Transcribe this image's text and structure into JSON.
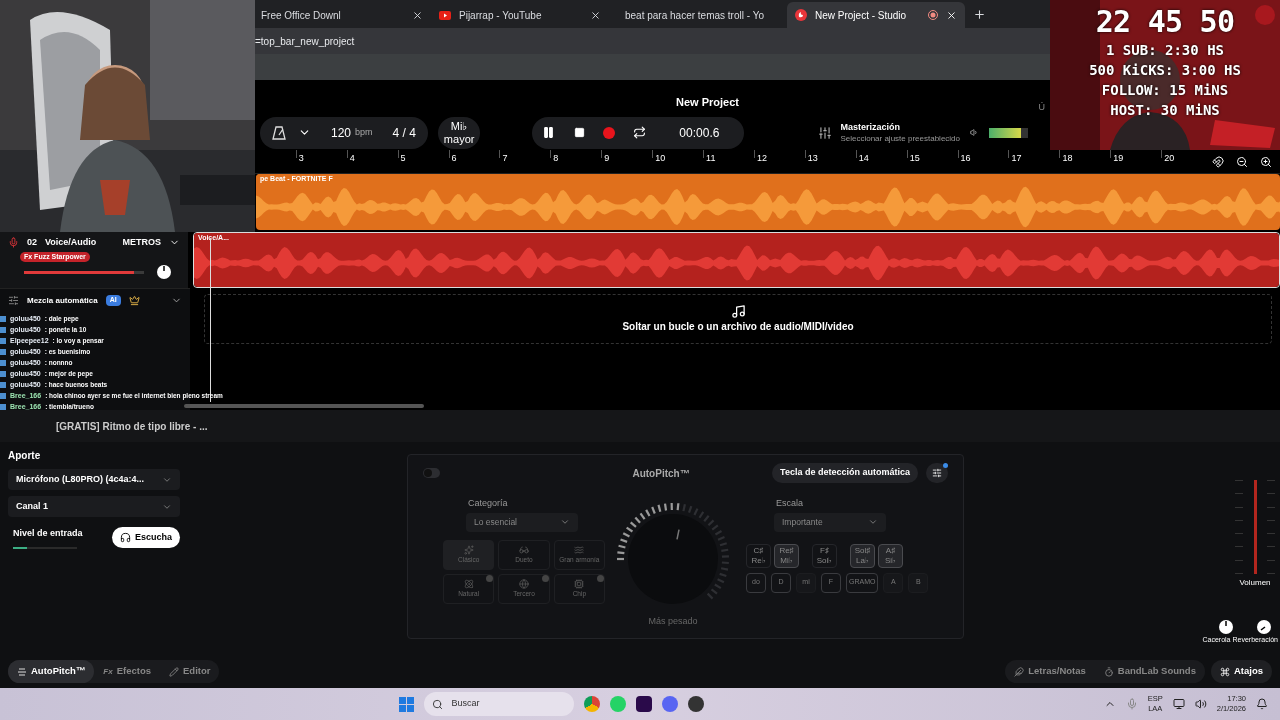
{
  "browser": {
    "tabs": [
      {
        "title": "Free Office Downl",
        "kind": "page",
        "selected": false
      },
      {
        "title": "Pijarrap - YouTube",
        "kind": "video",
        "selected": false
      },
      {
        "title": "beat para hacer temas troll - Yo",
        "kind": "video",
        "selected": false
      },
      {
        "title": "New Project - Studio",
        "kind": "studio",
        "selected": true
      }
    ],
    "address": "=top_bar_new_project"
  },
  "header": {
    "title": "New Project",
    "tempo": "120",
    "tempo_unit": "bpm",
    "time_signature": "4 / 4",
    "key_note": "Mi♭",
    "key_mode": "mayor",
    "playing": true,
    "time": "00:00.6",
    "mastering_title": "Masterización",
    "mastering_subtitle": "Seleccionar ajuste preestablecido",
    "master_volume": {
      "level": 0.8
    },
    "edge_text": "Ú"
  },
  "ruler": [
    "3",
    "4",
    "5",
    "6",
    "7",
    "8",
    "9",
    "10",
    "11",
    "12",
    "13",
    "14",
    "15",
    "16",
    "17",
    "18",
    "19",
    "20"
  ],
  "tracks": [
    {
      "clip": "pe Beat - FORTNITE  F",
      "color": "#e0701c"
    },
    {
      "number": "02",
      "name": "Voice/Audio",
      "meter_button": "METROS",
      "fx": "Fx Fuzz Starpower",
      "level": 0.92,
      "clip": "Voice/A...",
      "color": "#b4221e"
    }
  ],
  "automix": {
    "label": "Mezcla automática",
    "badge": "AI"
  },
  "drop_zone": "Soltar un bucle o un archivo de audio/MIDI/video",
  "now_playing": "[GRATIS] Ritmo de tipo libre - ...",
  "chat": [
    {
      "user": "goluu450",
      "message": ": dale pepe",
      "color": "#e8eef7"
    },
    {
      "user": "goluu450",
      "message": ": ponete la 10",
      "color": "#e8eef7"
    },
    {
      "user": "Elpeepee12",
      "message": ": lo voy a pensar",
      "color": "#e8eef7"
    },
    {
      "user": "goluu450",
      "message": ": es buenisimo",
      "color": "#e8eef7"
    },
    {
      "user": "goluu450",
      "message": ": nonnno",
      "color": "#e8eef7"
    },
    {
      "user": "goluu450",
      "message": ": mejor de pepe",
      "color": "#e8eef7"
    },
    {
      "user": "goluu450",
      "message": ": hace buenos beats",
      "color": "#e8eef7"
    },
    {
      "user": "Bree_166",
      "message": ": hola chinoo ayer se me fue el internet bien pleno stream",
      "color": "#9be3b0"
    },
    {
      "user": "Bree_166",
      "message": ": tiembla/trueno",
      "color": "#9be3b0"
    }
  ],
  "input": {
    "heading": "Aporte",
    "device": "Micrófono (L80PRO) (4c4a:4...",
    "channel": "Canal 1",
    "level_label": "Nivel de entrada",
    "level": 0.22,
    "listen_button": "Escucha"
  },
  "autopitch": {
    "enabled": false,
    "title": "AutoPitch™",
    "auto_key_button": "Tecla de detección automática",
    "category_label": "Categoría",
    "category": "Lo esencial",
    "presets": [
      {
        "name": "Clásico",
        "selected": true,
        "premium": false
      },
      {
        "name": "Dueto",
        "selected": false,
        "premium": false
      },
      {
        "name": "Gran armonía",
        "selected": false,
        "premium": false
      },
      {
        "name": "Natural",
        "selected": false,
        "premium": true
      },
      {
        "name": "Tercero",
        "selected": false,
        "premium": true
      },
      {
        "name": "Chip",
        "selected": false,
        "premium": true
      }
    ],
    "strength": {
      "label": "Más pesado",
      "level": 0.6
    },
    "scale_label": "Escala",
    "scale": "Importante",
    "sharps": [
      {
        "top": "C♯",
        "bottom": "Re♭",
        "selected": false
      },
      {
        "top": "Re♯",
        "bottom": "Mi♭",
        "selected": true
      },
      {
        "top": "F♯",
        "bottom": "Sol♭",
        "selected": false
      },
      {
        "top": "Sol♯",
        "bottom": "La♭",
        "selected": true
      },
      {
        "top": "A♯",
        "bottom": "Si♭",
        "selected": true
      }
    ],
    "naturals": [
      {
        "name": "do",
        "selected": true
      },
      {
        "name": "D",
        "selected": true
      },
      {
        "name": "mi",
        "selected": false
      },
      {
        "name": "F",
        "selected": true
      },
      {
        "name": "GRAMO",
        "selected": true
      },
      {
        "name": "A",
        "selected": false
      },
      {
        "name": "B",
        "selected": false
      }
    ]
  },
  "output": {
    "volume_label": "Volumen",
    "level": 1,
    "pan_label": "Cacerola",
    "reverb_label": "Reverberación"
  },
  "bottom_tabs": [
    {
      "label": "AutoPitch™",
      "selected": true
    },
    {
      "label": "Efectos",
      "prefix": "Fx",
      "selected": false
    },
    {
      "label": "Editor",
      "selected": false
    }
  ],
  "bottom_right": [
    "Letras/Notas",
    "BandLab Sounds",
    "Atajos"
  ],
  "overlay": {
    "timer": "22 45 50",
    "goals": [
      "1 SUB: 2:30 HS",
      "500 KiCKS: 3:00 HS",
      "FOLLOW: 15 MiNS",
      "HOST: 30 MiNS"
    ]
  },
  "taskbar": {
    "search": "Buscar",
    "lang_top": "ESP",
    "lang_bottom": "LAA",
    "time": "17:30",
    "date": "2/1/2026"
  }
}
